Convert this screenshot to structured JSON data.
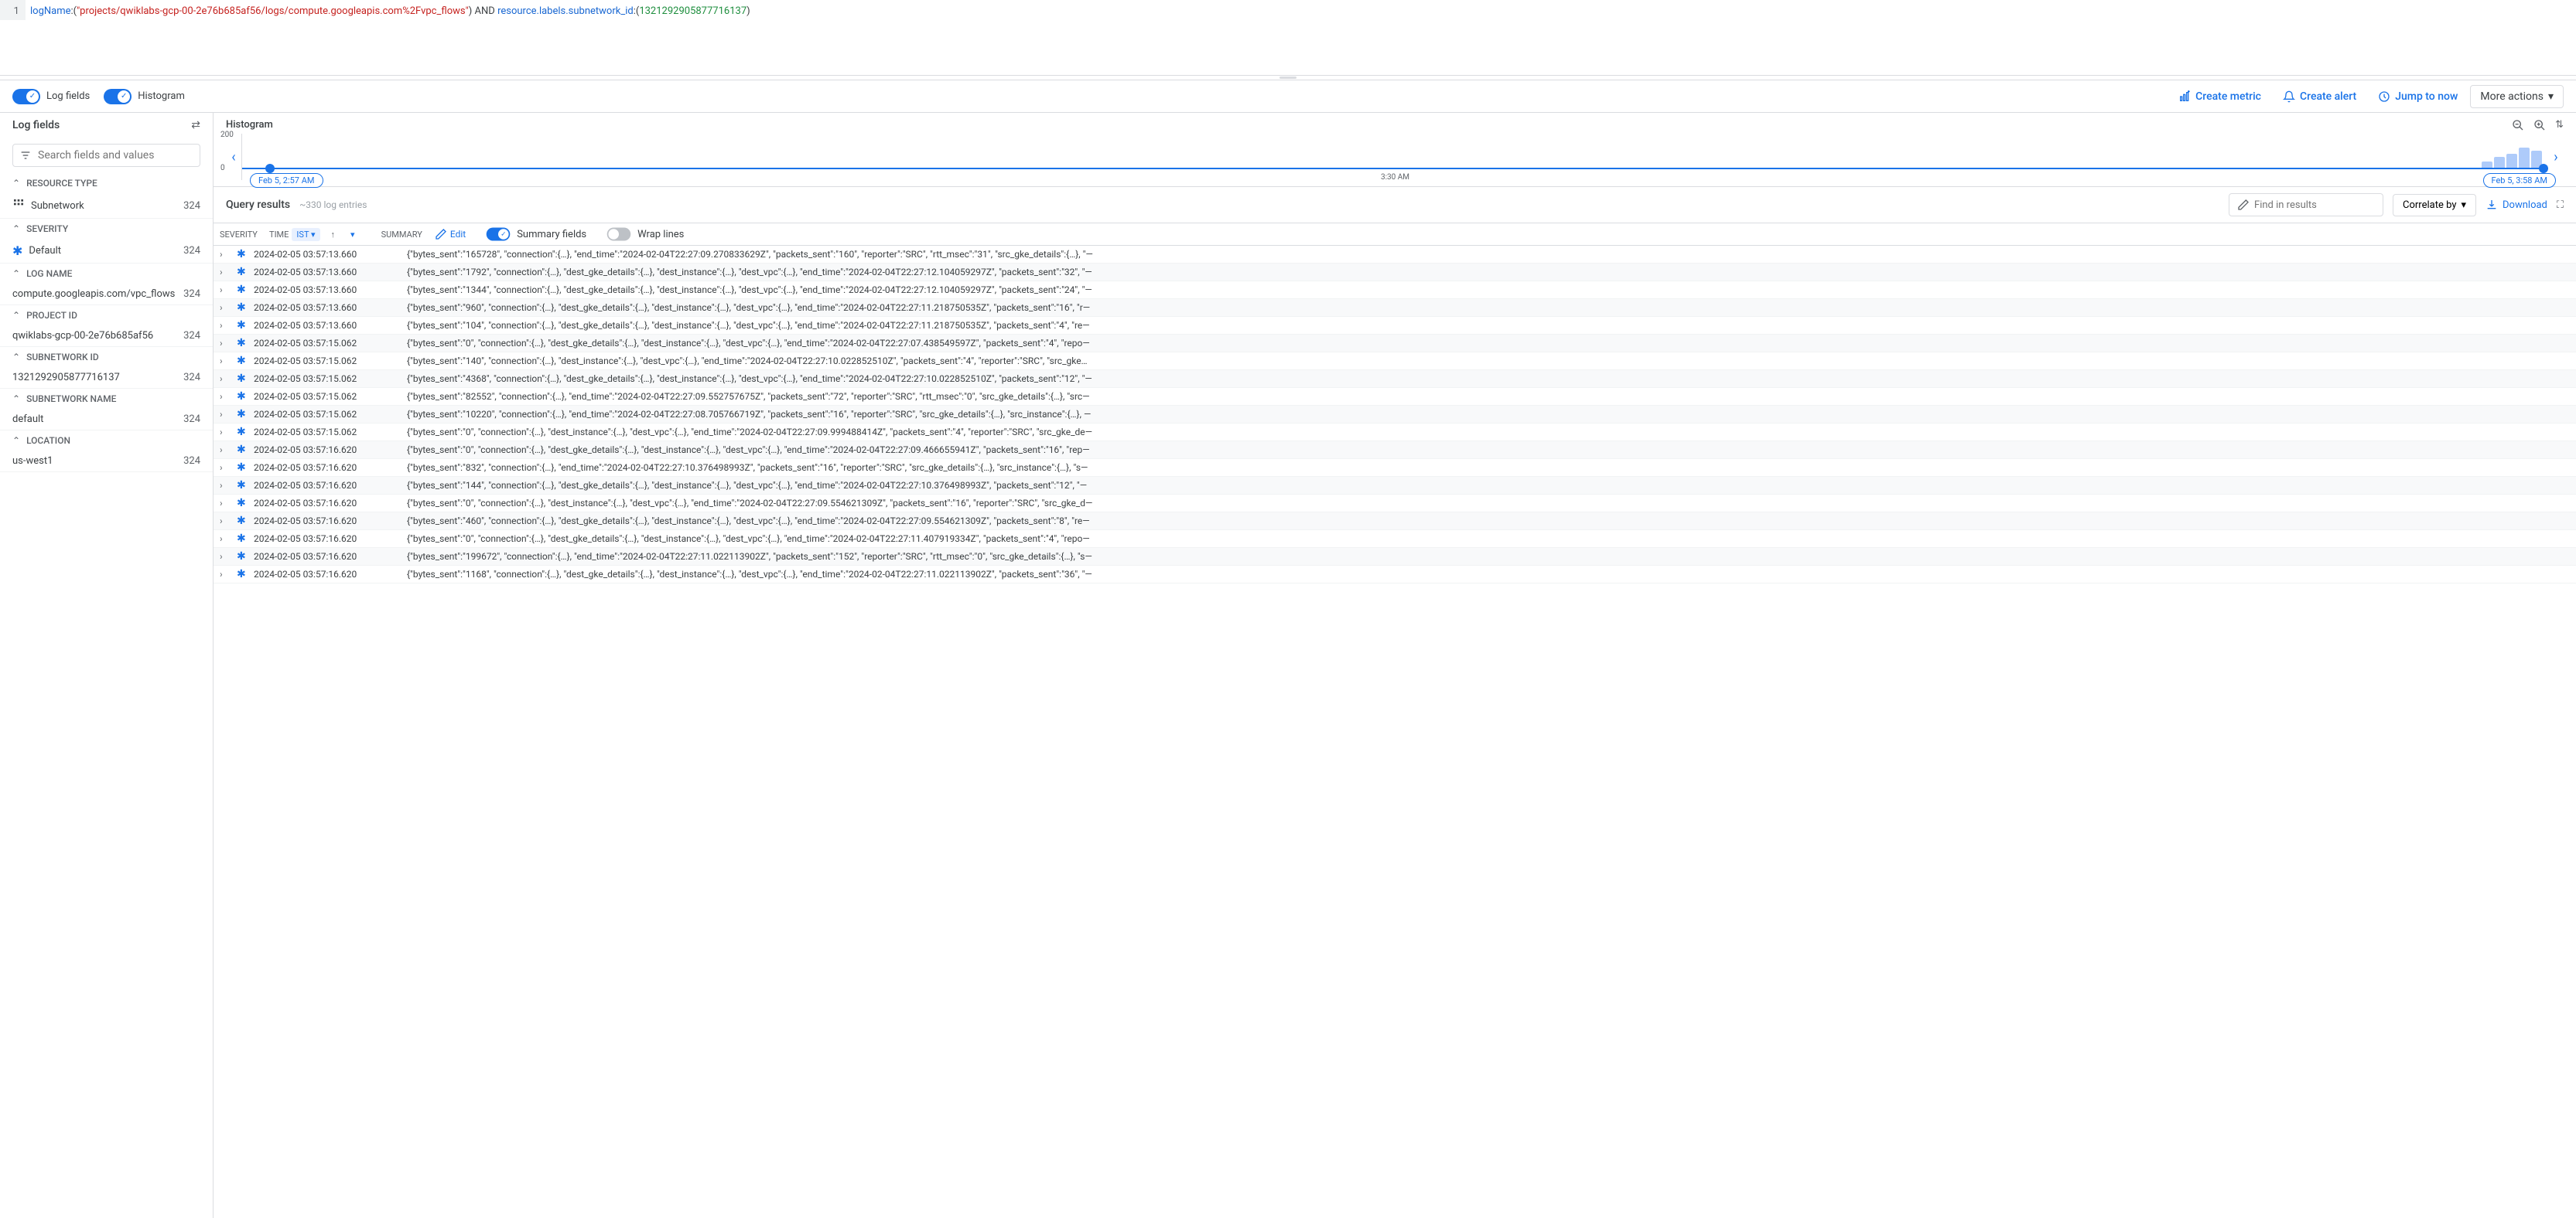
{
  "query": {
    "line": "1",
    "k1": "logName",
    "s1": "\"projects/qwiklabs-gcp-00-2e76b685af56/logs/compute.googleapis.com%2Fvpc_flows\"",
    "op": " AND ",
    "k2": "resource.labels.subnetwork_id",
    "n1": "1321292905877716137"
  },
  "toolbar": {
    "log_fields": "Log fields",
    "histogram": "Histogram",
    "create_metric": "Create metric",
    "create_alert": "Create alert",
    "jump_to_now": "Jump to now",
    "more_actions": "More actions"
  },
  "sidebar": {
    "title": "Log fields",
    "search_placeholder": "Search fields and values",
    "groups": [
      {
        "title": "RESOURCE TYPE",
        "items": [
          {
            "label": "Subnetwork",
            "count": "324",
            "icon": "grid"
          }
        ]
      },
      {
        "title": "SEVERITY",
        "items": [
          {
            "label": "Default",
            "count": "324",
            "icon": "star"
          }
        ]
      },
      {
        "title": "LOG NAME",
        "items": [
          {
            "label": "compute.googleapis.com/vpc_flows",
            "count": "324"
          }
        ]
      },
      {
        "title": "PROJECT ID",
        "items": [
          {
            "label": "qwiklabs-gcp-00-2e76b685af56",
            "count": "324"
          }
        ]
      },
      {
        "title": "SUBNETWORK ID",
        "items": [
          {
            "label": "1321292905877716137",
            "count": "324"
          }
        ]
      },
      {
        "title": "SUBNETWORK NAME",
        "items": [
          {
            "label": "default",
            "count": "324"
          }
        ]
      },
      {
        "title": "LOCATION",
        "items": [
          {
            "label": "us-west1",
            "count": "324"
          }
        ]
      }
    ]
  },
  "histogram": {
    "title": "Histogram",
    "y_max": "200",
    "y_min": "0",
    "start_label": "Feb 5, 2:57 AM",
    "mid_label": "3:30 AM",
    "end_label": "Feb 5, 3:58 AM"
  },
  "results": {
    "title": "Query results",
    "count": "~330 log entries",
    "find_placeholder": "Find in results",
    "correlate": "Correlate by",
    "download": "Download",
    "col_severity": "SEVERITY",
    "col_time": "TIME",
    "tz": "IST",
    "col_summary": "SUMMARY",
    "edit": "Edit",
    "summary_fields": "Summary fields",
    "wrap_lines": "Wrap lines"
  },
  "rows": [
    {
      "ts": "2024-02-05 03:57:13.660",
      "s": "{\"bytes_sent\":\"165728\", \"connection\":{…}, \"end_time\":\"2024-02-04T22:27:09.270833629Z\", \"packets_sent\":\"160\", \"reporter\":\"SRC\", \"rtt_msec\":\"31\", \"src_gke_details\":{…}, \"—"
    },
    {
      "ts": "2024-02-05 03:57:13.660",
      "s": "{\"bytes_sent\":\"1792\", \"connection\":{…}, \"dest_gke_details\":{…}, \"dest_instance\":{…}, \"dest_vpc\":{…}, \"end_time\":\"2024-02-04T22:27:12.104059297Z\", \"packets_sent\":\"32\", \"—"
    },
    {
      "ts": "2024-02-05 03:57:13.660",
      "s": "{\"bytes_sent\":\"1344\", \"connection\":{…}, \"dest_gke_details\":{…}, \"dest_instance\":{…}, \"dest_vpc\":{…}, \"end_time\":\"2024-02-04T22:27:12.104059297Z\", \"packets_sent\":\"24\", \"—"
    },
    {
      "ts": "2024-02-05 03:57:13.660",
      "s": "{\"bytes_sent\":\"960\", \"connection\":{…}, \"dest_gke_details\":{…}, \"dest_instance\":{…}, \"dest_vpc\":{…}, \"end_time\":\"2024-02-04T22:27:11.218750535Z\", \"packets_sent\":\"16\", \"r—"
    },
    {
      "ts": "2024-02-05 03:57:13.660",
      "s": "{\"bytes_sent\":\"104\", \"connection\":{…}, \"dest_gke_details\":{…}, \"dest_instance\":{…}, \"dest_vpc\":{…}, \"end_time\":\"2024-02-04T22:27:11.218750535Z\", \"packets_sent\":\"4\", \"re—"
    },
    {
      "ts": "2024-02-05 03:57:15.062",
      "s": "{\"bytes_sent\":\"0\", \"connection\":{…}, \"dest_gke_details\":{…}, \"dest_instance\":{…}, \"dest_vpc\":{…}, \"end_time\":\"2024-02-04T22:27:07.438549597Z\", \"packets_sent\":\"4\", \"repo—"
    },
    {
      "ts": "2024-02-05 03:57:15.062",
      "s": "{\"bytes_sent\":\"140\", \"connection\":{…}, \"dest_instance\":{…}, \"dest_vpc\":{…}, \"end_time\":\"2024-02-04T22:27:10.022852510Z\", \"packets_sent\":\"4\", \"reporter\":\"SRC\", \"src_gke…"
    },
    {
      "ts": "2024-02-05 03:57:15.062",
      "s": "{\"bytes_sent\":\"4368\", \"connection\":{…}, \"dest_gke_details\":{…}, \"dest_instance\":{…}, \"dest_vpc\":{…}, \"end_time\":\"2024-02-04T22:27:10.022852510Z\", \"packets_sent\":\"12\", \"—"
    },
    {
      "ts": "2024-02-05 03:57:15.062",
      "s": "{\"bytes_sent\":\"82552\", \"connection\":{…}, \"end_time\":\"2024-02-04T22:27:09.552757675Z\", \"packets_sent\":\"72\", \"reporter\":\"SRC\", \"rtt_msec\":\"0\", \"src_gke_details\":{…}, \"src—"
    },
    {
      "ts": "2024-02-05 03:57:15.062",
      "s": "{\"bytes_sent\":\"10220\", \"connection\":{…}, \"end_time\":\"2024-02-04T22:27:08.705766719Z\", \"packets_sent\":\"16\", \"reporter\":\"SRC\", \"src_gke_details\":{…}, \"src_instance\":{…}, —"
    },
    {
      "ts": "2024-02-05 03:57:15.062",
      "s": "{\"bytes_sent\":\"0\", \"connection\":{…}, \"dest_instance\":{…}, \"dest_vpc\":{…}, \"end_time\":\"2024-02-04T22:27:09.999488414Z\", \"packets_sent\":\"4\", \"reporter\":\"SRC\", \"src_gke_de—"
    },
    {
      "ts": "2024-02-05 03:57:16.620",
      "s": "{\"bytes_sent\":\"0\", \"connection\":{…}, \"dest_gke_details\":{…}, \"dest_instance\":{…}, \"dest_vpc\":{…}, \"end_time\":\"2024-02-04T22:27:09.466655941Z\", \"packets_sent\":\"16\", \"rep—"
    },
    {
      "ts": "2024-02-05 03:57:16.620",
      "s": "{\"bytes_sent\":\"832\", \"connection\":{…}, \"end_time\":\"2024-02-04T22:27:10.376498993Z\", \"packets_sent\":\"16\", \"reporter\":\"SRC\", \"src_gke_details\":{…}, \"src_instance\":{…}, \"s—"
    },
    {
      "ts": "2024-02-05 03:57:16.620",
      "s": "{\"bytes_sent\":\"144\", \"connection\":{…}, \"dest_gke_details\":{…}, \"dest_instance\":{…}, \"dest_vpc\":{…}, \"end_time\":\"2024-02-04T22:27:10.376498993Z\", \"packets_sent\":\"12\", \"—"
    },
    {
      "ts": "2024-02-05 03:57:16.620",
      "s": "{\"bytes_sent\":\"0\", \"connection\":{…}, \"dest_instance\":{…}, \"dest_vpc\":{…}, \"end_time\":\"2024-02-04T22:27:09.554621309Z\", \"packets_sent\":\"16\", \"reporter\":\"SRC\", \"src_gke_d—"
    },
    {
      "ts": "2024-02-05 03:57:16.620",
      "s": "{\"bytes_sent\":\"460\", \"connection\":{…}, \"dest_gke_details\":{…}, \"dest_instance\":{…}, \"dest_vpc\":{…}, \"end_time\":\"2024-02-04T22:27:09.554621309Z\", \"packets_sent\":\"8\", \"re—"
    },
    {
      "ts": "2024-02-05 03:57:16.620",
      "s": "{\"bytes_sent\":\"0\", \"connection\":{…}, \"dest_gke_details\":{…}, \"dest_instance\":{…}, \"dest_vpc\":{…}, \"end_time\":\"2024-02-04T22:27:11.407919334Z\", \"packets_sent\":\"4\", \"repo—"
    },
    {
      "ts": "2024-02-05 03:57:16.620",
      "s": "{\"bytes_sent\":\"199672\", \"connection\":{…}, \"end_time\":\"2024-02-04T22:27:11.022113902Z\", \"packets_sent\":\"152\", \"reporter\":\"SRC\", \"rtt_msec\":\"0\", \"src_gke_details\":{…}, \"s—"
    },
    {
      "ts": "2024-02-05 03:57:16.620",
      "s": "{\"bytes_sent\":\"1168\", \"connection\":{…}, \"dest_gke_details\":{…}, \"dest_instance\":{…}, \"dest_vpc\":{…}, \"end_time\":\"2024-02-04T22:27:11.022113902Z\", \"packets_sent\":\"36\", \"—"
    }
  ],
  "chart_data": {
    "type": "bar",
    "title": "Histogram",
    "ylim": [
      0,
      200
    ],
    "x_start": "Feb 5, 2:57 AM",
    "x_end": "Feb 5, 3:58 AM",
    "x_mid": "3:30 AM",
    "bars_visible_at_end": [
      30,
      55,
      70,
      100,
      85
    ]
  }
}
